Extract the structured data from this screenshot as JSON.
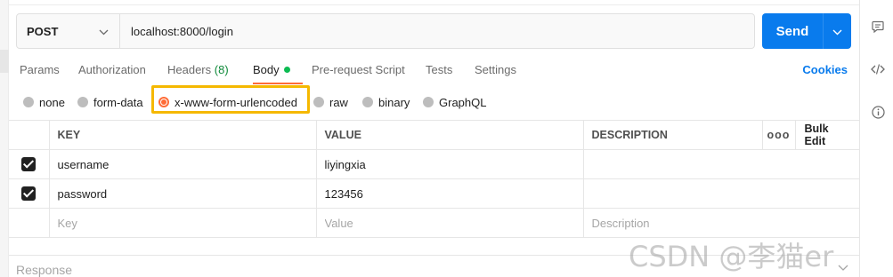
{
  "request": {
    "method": "POST",
    "url": "localhost:8000/login",
    "send_label": "Send"
  },
  "tabs": [
    {
      "label": "Params"
    },
    {
      "label": "Authorization"
    },
    {
      "label": "Headers",
      "count": "(8)"
    },
    {
      "label": "Body",
      "active": true
    },
    {
      "label": "Pre-request Script"
    },
    {
      "label": "Tests"
    },
    {
      "label": "Settings"
    }
  ],
  "cookies_label": "Cookies",
  "body_types": [
    {
      "label": "none"
    },
    {
      "label": "form-data"
    },
    {
      "label": "x-www-form-urlencoded",
      "selected": true
    },
    {
      "label": "raw"
    },
    {
      "label": "binary"
    },
    {
      "label": "GraphQL"
    }
  ],
  "table": {
    "headers": {
      "key": "KEY",
      "value": "VALUE",
      "description": "DESCRIPTION",
      "more": "ooo",
      "bulk_edit": "Bulk Edit"
    },
    "rows": [
      {
        "key": "username",
        "value": "liyingxia",
        "description": "",
        "checked": true
      },
      {
        "key": "password",
        "value": "123456",
        "description": "",
        "checked": true
      }
    ],
    "placeholders": {
      "key": "Key",
      "value": "Value",
      "description": "Description"
    }
  },
  "response": {
    "label": "Response"
  },
  "watermark": "CSDN @李猫er",
  "colors": {
    "accent": "#ff6c37",
    "send": "#097bed",
    "link": "#097bed",
    "body_dot": "#0cbb52",
    "highlight": "#f5b800"
  },
  "icons": {
    "right_panel": [
      "comment-icon",
      "code-icon",
      "info-icon"
    ],
    "method_dropdown": "chevron-down-icon",
    "send_dropdown": "chevron-down-icon",
    "response_toggle": "chevron-down-icon"
  }
}
